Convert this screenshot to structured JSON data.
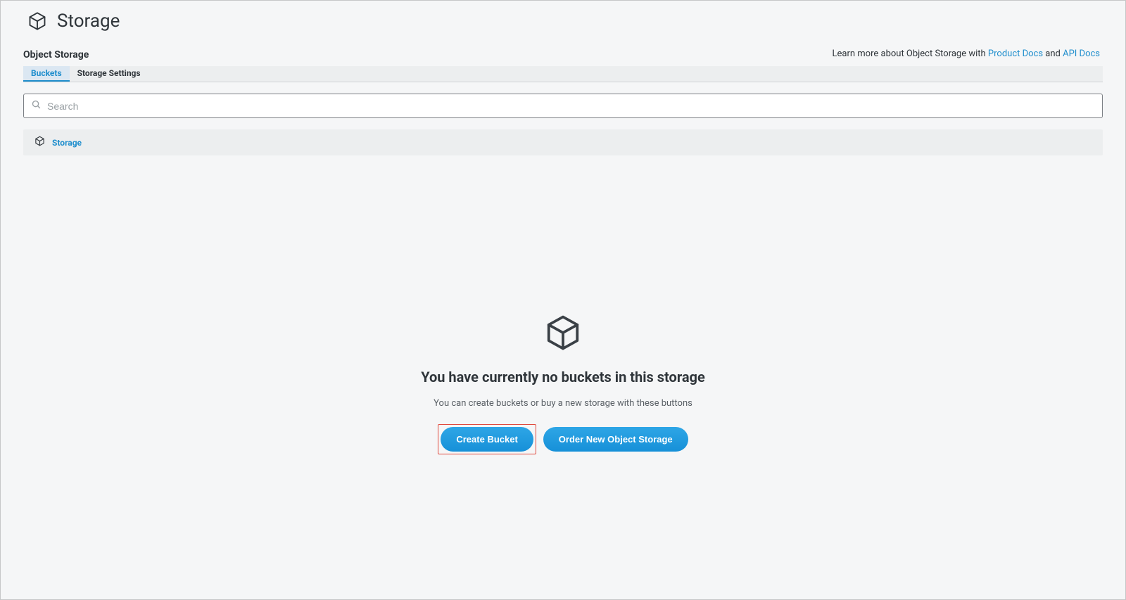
{
  "header": {
    "title": "Storage"
  },
  "subheader": {
    "section_title": "Object Storage",
    "learn_more_prefix": "Learn more about Object Storage with ",
    "product_docs_label": "Product Docs",
    "and_text": " and ",
    "api_docs_label": "API Docs"
  },
  "tabs": {
    "buckets": "Buckets",
    "settings": "Storage Settings"
  },
  "search": {
    "placeholder": "Search"
  },
  "breadcrumb": {
    "root": "Storage"
  },
  "empty_state": {
    "heading": "You have currently no buckets in this storage",
    "hint": "You can create buckets or buy a new storage with these buttons",
    "create_label": "Create Bucket",
    "order_label": "Order New Object Storage"
  }
}
